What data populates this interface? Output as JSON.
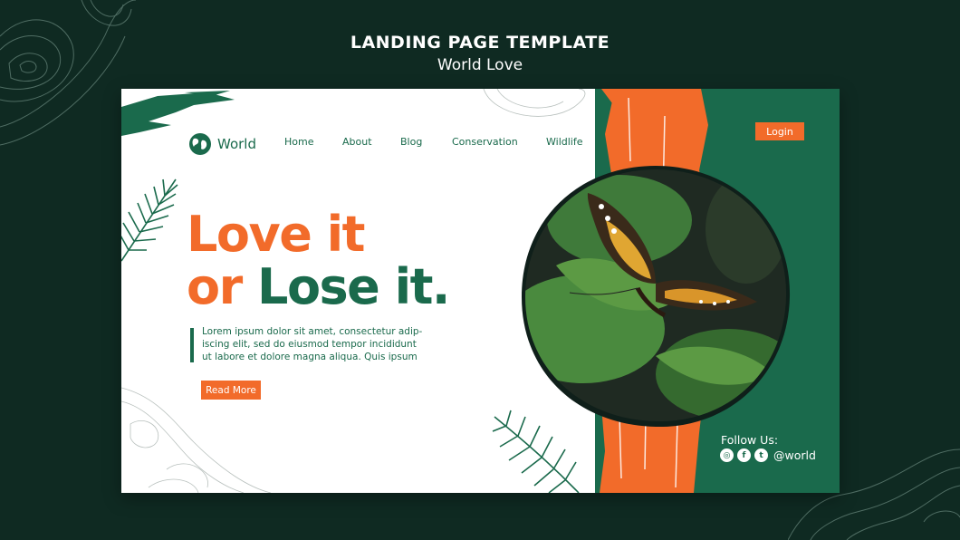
{
  "header": {
    "title": "LANDING PAGE TEMPLATE",
    "subtitle": "World Love"
  },
  "logo": {
    "text": "World",
    "icon": "globe-icon"
  },
  "nav": {
    "items": [
      "Home",
      "About",
      "Blog",
      "Conservation",
      "Wildlife"
    ]
  },
  "login_label": "Login",
  "hero": {
    "line1": "Love it",
    "line2_a": "or ",
    "line2_b": "Lose it.",
    "body": "Lorem ipsum dolor sit amet, consectetur adip-iscing elit, sed do eiusmod tempor incididunt ut labore et dolore magna aliqua. Quis ipsum",
    "cta": "Read More"
  },
  "social": {
    "follow_label": "Follow Us:",
    "icons": [
      "instagram-icon",
      "facebook-icon",
      "twitter-icon"
    ],
    "handle": "@world"
  },
  "colors": {
    "background": "#0f2a22",
    "green": "#1a6a4c",
    "orange": "#f26b2a",
    "white": "#ffffff"
  }
}
